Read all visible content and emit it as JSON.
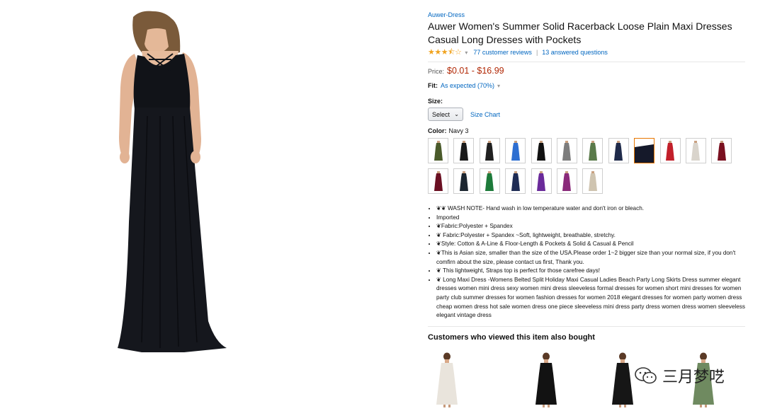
{
  "product": {
    "brand": "Auwer-Dress",
    "title": "Auwer Women's Summer Solid Racerback Loose Plain Maxi Dresses Casual Long Dresses with Pockets",
    "rating_stars": 3.5,
    "reviews_link": "77 customer reviews",
    "questions_link": "13 answered questions",
    "price_label": "Price:",
    "price_value": "$0.01 - $16.99",
    "fit_label": "Fit:",
    "fit_value": "As expected (70%)",
    "size_label": "Size:",
    "size_select": "Select",
    "size_chart": "Size Chart",
    "color_label": "Color:",
    "color_value": "Navy 3"
  },
  "swatches": [
    {
      "color": "#4a5a2a",
      "selected": false
    },
    {
      "color": "#1a1a1a",
      "selected": false
    },
    {
      "color": "#202020",
      "selected": false
    },
    {
      "color": "#2e6fd1",
      "selected": false
    },
    {
      "color": "#111111",
      "selected": false
    },
    {
      "color": "#7d7d7d",
      "selected": false
    },
    {
      "color": "#5a7a4a",
      "selected": false
    },
    {
      "color": "#1f2a4a",
      "selected": false
    },
    {
      "color": "#15192a",
      "selected": true
    },
    {
      "color": "#c21f2a",
      "selected": false
    },
    {
      "color": "#d9d4cc",
      "selected": false
    },
    {
      "color": "#7a1020",
      "selected": false
    },
    {
      "color": "#6a0f22",
      "selected": false
    },
    {
      "color": "#1c2630",
      "selected": false
    },
    {
      "color": "#1d7a3a",
      "selected": false
    },
    {
      "color": "#1f2c55",
      "selected": false
    },
    {
      "color": "#6a2a9a",
      "selected": false
    },
    {
      "color": "#8a2a7a",
      "selected": false
    },
    {
      "color": "#cfc4b0",
      "selected": false
    }
  ],
  "bullets": [
    "❦❦ WASH NOTE- Hand wash in low temperature water and don't iron or bleach.",
    "Imported",
    "❦Fabric:Polyester + Spandex",
    "❦ Fabric:Polyester + Spandex ~Soft, lightweight, breathable, stretchy.",
    "❦Style: Cotton & A-Line & Floor-Length & Pockets & Solid & Casual & Pencil",
    "❦This is Asian size, smaller than the size of the USA.Please order 1~2 bigger size than your normal size, if you don't comfirn about the size, please contact us first, Thank you.",
    "❦ This lightweight, Straps top is perfect for those carefree days!",
    "❦ Long Maxi Dress -Womens Belted Split Holiday Maxi Casual Ladies Beach Party Long Skirts Dress summer elegant dresses women mini dress sexy women mini dress sleeveless formal dresses for women short mini dresses for women party club summer dresses for women fashion dresses for women 2018 elegant dresses for women party women dress cheap women dress hot sale women dress one piece sleeveless mini dress party dress women dress women sleeveless elegant vintage dress"
  ],
  "also_bought": {
    "title": "Customers who viewed this item also bought",
    "items": [
      {
        "color": "#e9e4dc"
      },
      {
        "color": "#121212"
      },
      {
        "color": "#161616"
      },
      {
        "color": "#6f8a60"
      }
    ]
  },
  "watermark": {
    "text": "三月梦呓"
  },
  "colors": {
    "link": "#0066c0",
    "price": "#b12704",
    "star": "#f0a31f",
    "selected_border": "#e77600",
    "dress": "#111318"
  }
}
